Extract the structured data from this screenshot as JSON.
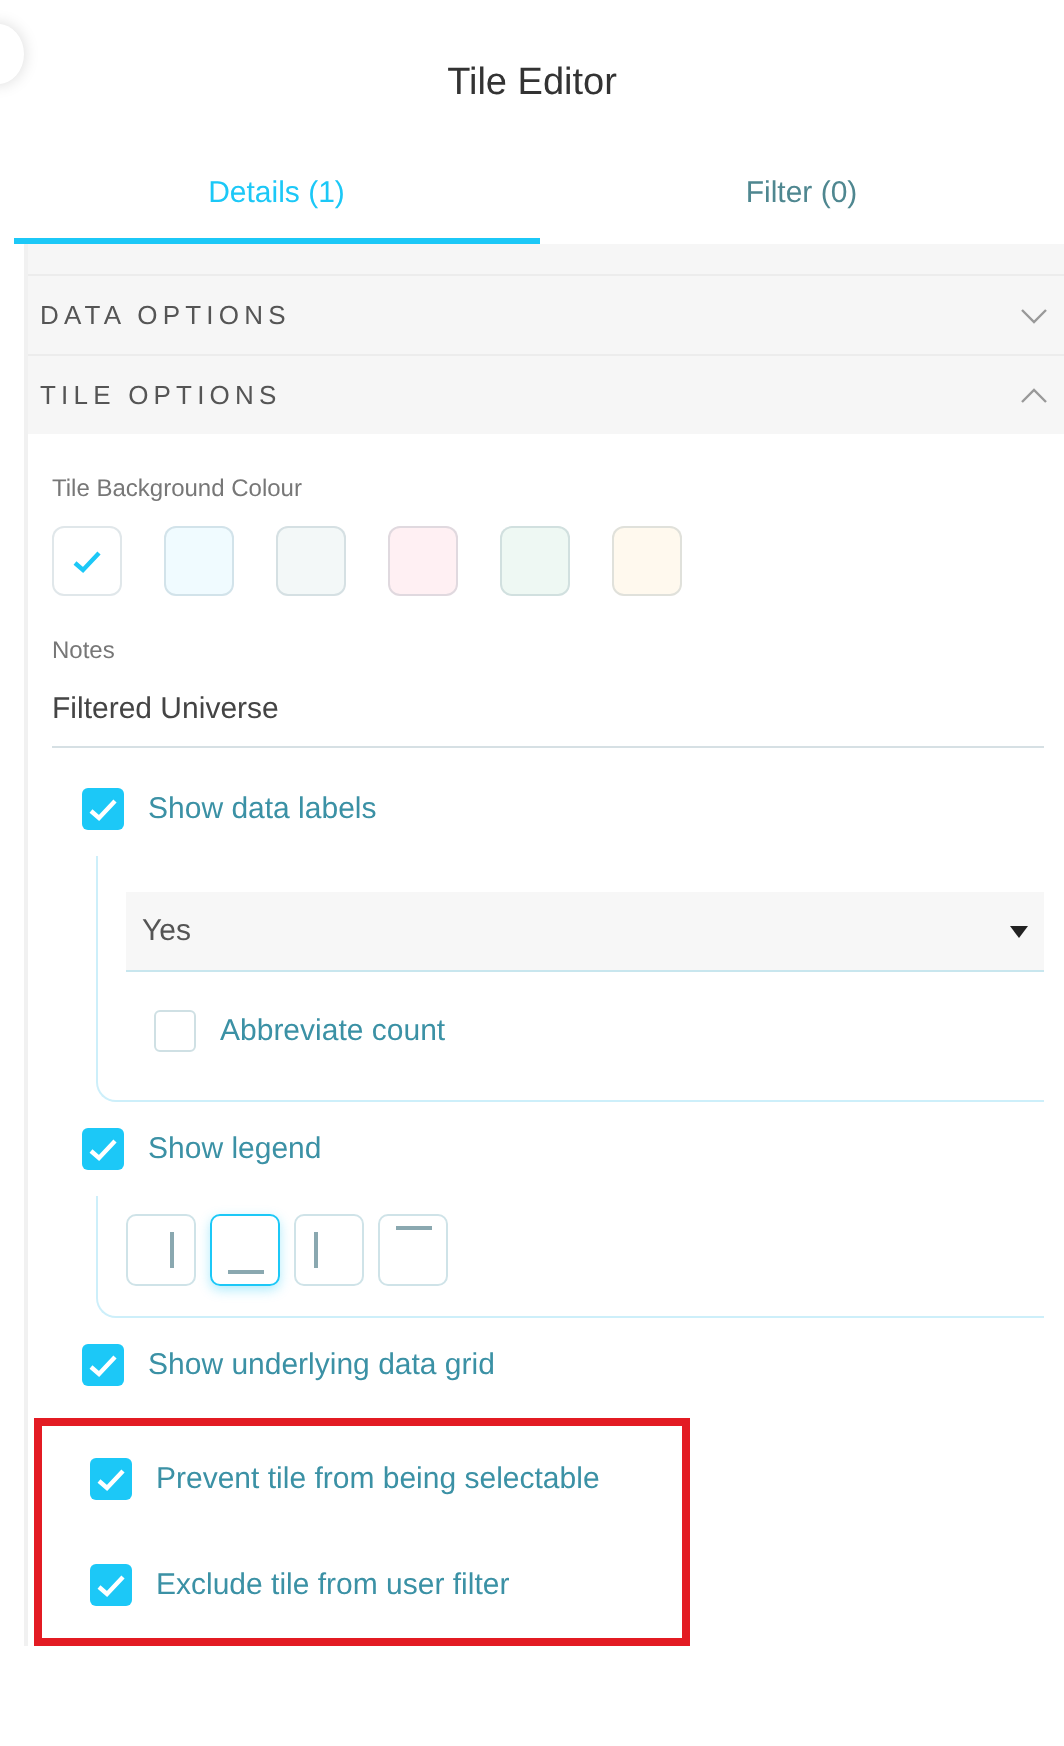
{
  "title": "Tile Editor",
  "tabs": [
    {
      "label": "Details (1)",
      "selected": true
    },
    {
      "label": "Filter (0)",
      "selected": false
    }
  ],
  "sections": [
    {
      "title": "DATA OPTIONS",
      "expanded": false
    },
    {
      "title": "TILE OPTIONS",
      "expanded": true
    }
  ],
  "tile_options": {
    "background_label": "Tile Background Colour",
    "swatches": [
      {
        "color": "#ffffff",
        "selected": true
      },
      {
        "color": "#f0fbff",
        "selected": false
      },
      {
        "color": "#f3f8f8",
        "selected": false
      },
      {
        "color": "#fff0f3",
        "selected": false
      },
      {
        "color": "#eef8f3",
        "selected": false
      },
      {
        "color": "#fff9ee",
        "selected": false
      }
    ],
    "notes": {
      "label": "Notes",
      "value": "Filtered Universe"
    },
    "options": [
      {
        "kind": "data_labels",
        "label": "Show data labels",
        "checked": true,
        "highlighted": false,
        "select_value": "Yes",
        "sub_option": {
          "label": "Abbreviate count",
          "checked": false
        }
      },
      {
        "kind": "legend",
        "label": "Show legend",
        "checked": true,
        "highlighted": false,
        "positions": [
          {
            "kind": "right",
            "selected": false
          },
          {
            "kind": "bottom",
            "selected": true
          },
          {
            "kind": "left",
            "selected": false
          },
          {
            "kind": "top",
            "selected": false
          }
        ]
      },
      {
        "kind": "plain",
        "label": "Show underlying data grid",
        "checked": true,
        "highlighted": false
      },
      {
        "kind": "plain",
        "label": "Prevent tile from being selectable",
        "checked": true,
        "highlighted": true
      },
      {
        "kind": "plain",
        "label": "Exclude tile from user filter",
        "checked": true,
        "highlighted": true
      }
    ]
  }
}
